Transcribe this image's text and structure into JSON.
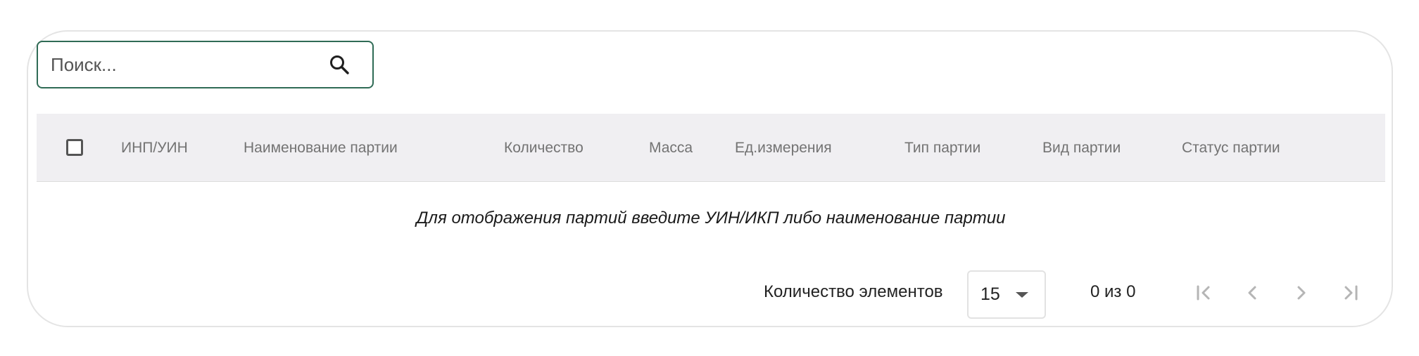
{
  "search": {
    "placeholder": "Поиск...",
    "value": ""
  },
  "table": {
    "columns": [
      "ИНП/УИН",
      "Наименование партии",
      "Количество",
      "Масса",
      "Ед.измерения",
      "Тип партии",
      "Вид партии",
      "Статус партии"
    ],
    "rows": [],
    "empty_message": "Для отображения партий введите УИН/ИКП либо наименование партии"
  },
  "pagination": {
    "items_per_page_label": "Количество элементов",
    "page_size": "15",
    "range_text": "0 из 0"
  },
  "colors": {
    "search_border": "#2f6b55",
    "header_bg": "#f0eff2",
    "card_border": "#e4e4e4",
    "nav_icon_disabled": "#b5b5b5"
  },
  "icons": {
    "search": "search-icon",
    "first_page": "first-page-icon",
    "prev_page": "chevron-left-icon",
    "next_page": "chevron-right-icon",
    "last_page": "last-page-icon",
    "dropdown": "caret-down-icon"
  }
}
